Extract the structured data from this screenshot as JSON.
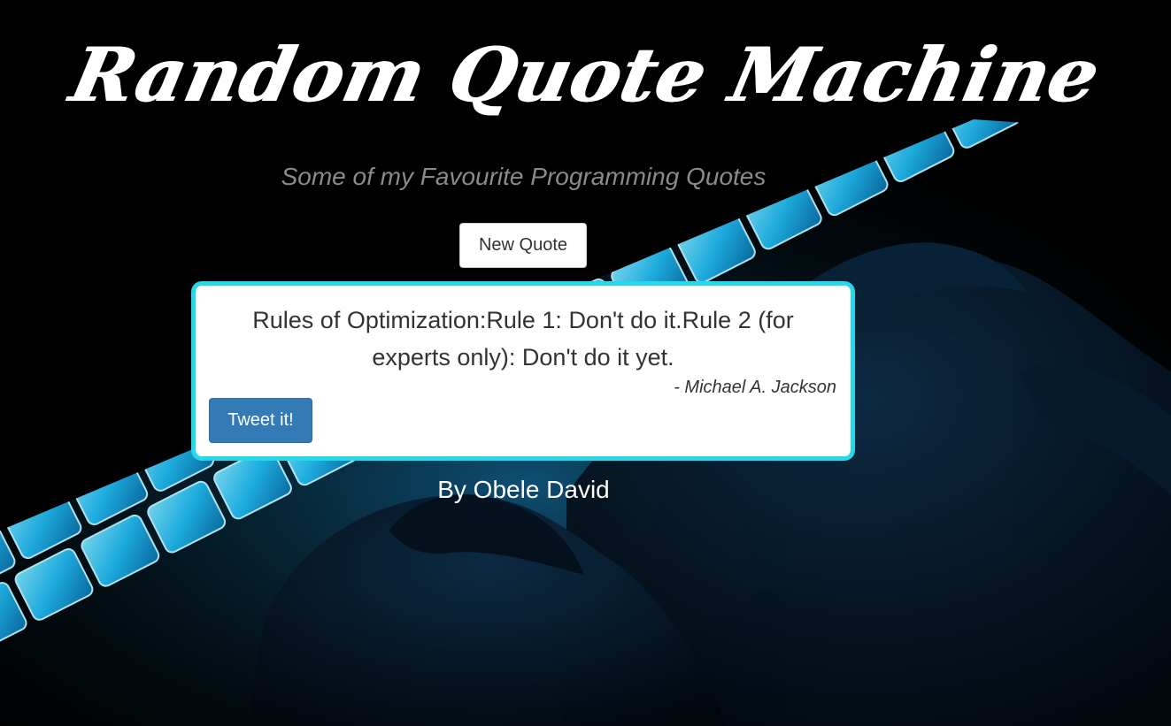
{
  "header": {
    "title": "Random Quote Machine",
    "subtitle": "Some of my Favourite Programming Quotes"
  },
  "controls": {
    "new_quote_label": "New Quote"
  },
  "quote": {
    "text": "Rules of Optimization:Rule 1: Don't do it.Rule 2 (for experts only): Don't do it yet.",
    "author": "- Michael A. Jackson",
    "tweet_label": "Tweet it!"
  },
  "footer": {
    "credit": "By Obele David"
  },
  "colors": {
    "card_border": "#27d7ea",
    "tweet_button": "#337ab7",
    "subtitle_text": "#8a8a8a",
    "background": "#000000",
    "keyboard_glow": "#2fc6f5"
  },
  "background_image": {
    "icon": "glowing-keyboard-hands-image"
  }
}
